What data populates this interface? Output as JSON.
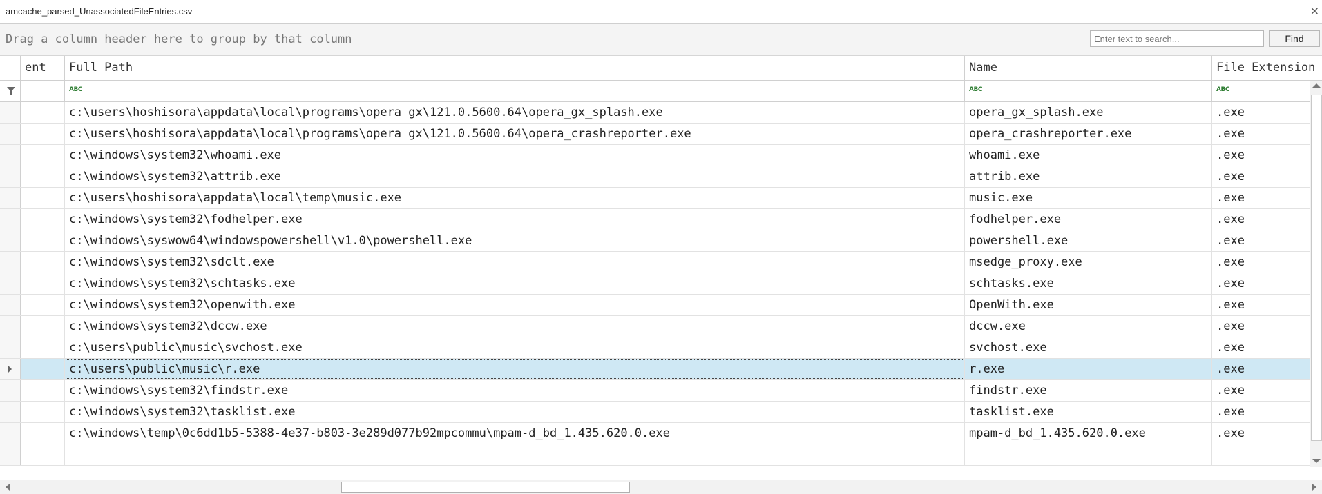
{
  "window": {
    "title": "amcache_parsed_UnassociatedFileEntries.csv",
    "close_glyph": "×"
  },
  "group_panel": {
    "hint": "Drag a column header here to group by that column",
    "search_placeholder": "Enter text to search...",
    "find_label": "Find"
  },
  "grid": {
    "columns": [
      "ent",
      "Full Path",
      "Name",
      "File Extension"
    ],
    "filter_badge": "ABC",
    "rows": [
      {
        "path": "c:\\users\\hoshisora\\appdata\\local\\programs\\opera gx\\121.0.5600.64\\opera_gx_splash.exe",
        "name": "opera_gx_splash.exe",
        "ext": ".exe"
      },
      {
        "path": "c:\\users\\hoshisora\\appdata\\local\\programs\\opera gx\\121.0.5600.64\\opera_crashreporter.exe",
        "name": "opera_crashreporter.exe",
        "ext": ".exe"
      },
      {
        "path": "c:\\windows\\system32\\whoami.exe",
        "name": "whoami.exe",
        "ext": ".exe"
      },
      {
        "path": "c:\\windows\\system32\\attrib.exe",
        "name": "attrib.exe",
        "ext": ".exe"
      },
      {
        "path": "c:\\users\\hoshisora\\appdata\\local\\temp\\music.exe",
        "name": "music.exe",
        "ext": ".exe"
      },
      {
        "path": "c:\\windows\\system32\\fodhelper.exe",
        "name": "fodhelper.exe",
        "ext": ".exe"
      },
      {
        "path": "c:\\windows\\syswow64\\windowspowershell\\v1.0\\powershell.exe",
        "name": "powershell.exe",
        "ext": ".exe"
      },
      {
        "path": "c:\\windows\\system32\\sdclt.exe",
        "name": "msedge_proxy.exe",
        "ext": ".exe"
      },
      {
        "path": "c:\\windows\\system32\\schtasks.exe",
        "name": "schtasks.exe",
        "ext": ".exe"
      },
      {
        "path": "c:\\windows\\system32\\openwith.exe",
        "name": "OpenWith.exe",
        "ext": ".exe"
      },
      {
        "path": "c:\\windows\\system32\\dccw.exe",
        "name": "dccw.exe",
        "ext": ".exe"
      },
      {
        "path": "c:\\users\\public\\music\\svchost.exe",
        "name": "svchost.exe",
        "ext": ".exe"
      },
      {
        "path": "c:\\users\\public\\music\\r.exe",
        "name": "r.exe",
        "ext": ".exe",
        "selected": true
      },
      {
        "path": "c:\\windows\\system32\\findstr.exe",
        "name": "findstr.exe",
        "ext": ".exe"
      },
      {
        "path": "c:\\windows\\system32\\tasklist.exe",
        "name": "tasklist.exe",
        "ext": ".exe"
      },
      {
        "path": "c:\\windows\\temp\\0c6dd1b5-5388-4e37-b803-3e289d077b92mpcommu\\mpam-d_bd_1.435.620.0.exe",
        "name": "mpam-d_bd_1.435.620.0.exe",
        "ext": ".exe"
      },
      {
        "path": "",
        "name": "",
        "ext": ""
      }
    ]
  },
  "colors": {
    "selected_row": "#cfe8f4",
    "filter_badge": "#2e7d32"
  }
}
